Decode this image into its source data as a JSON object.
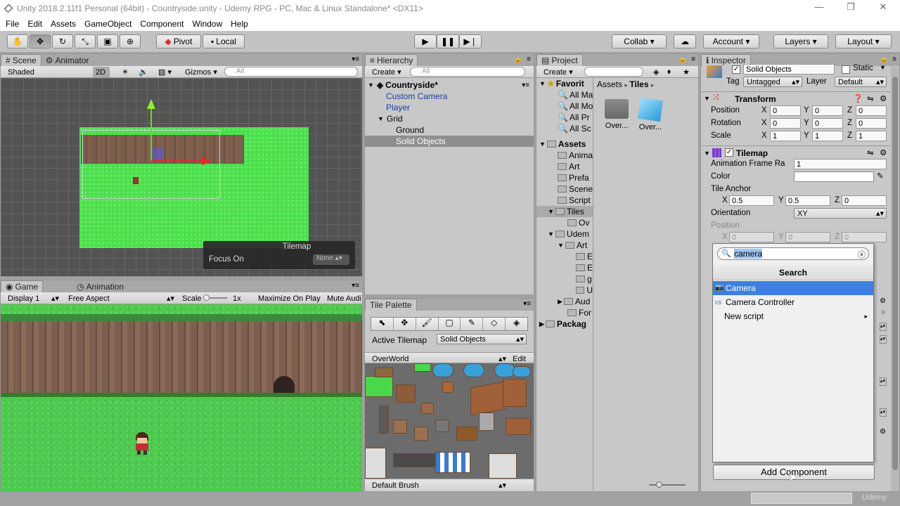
{
  "window": {
    "title": "Unity 2018.2.11f1 Personal (64bit) - Countryside.unity - Udemy RPG - PC, Mac & Linux Standalone* <DX11>"
  },
  "menu": [
    "File",
    "Edit",
    "Assets",
    "GameObject",
    "Component",
    "Window",
    "Help"
  ],
  "toolbar": {
    "pivot": "Pivot",
    "local": "Local",
    "collab": "Collab ▾",
    "account": "Account ▾",
    "layers": "Layers ▾",
    "layout": "Layout ▾"
  },
  "scene": {
    "tab": "Scene",
    "tab2": "Animator",
    "shading": "Shaded",
    "mode2d": "2D",
    "gizmos": "Gizmos ▾",
    "search_placeholder": "All",
    "overlay_title": "Tilemap",
    "focus_label": "Focus On",
    "focus_value": "None"
  },
  "game": {
    "tab": "Game",
    "tab2": "Animation",
    "display": "Display 1",
    "aspect": "Free Aspect",
    "scale_label": "Scale",
    "scale_value": "1x",
    "maximize": "Maximize On Play",
    "mute": "Mute Audi"
  },
  "hierarchy": {
    "tab": "Hierarchy",
    "create": "Create ▾",
    "search_placeholder": "All",
    "scene": "Countryside*",
    "items": [
      "Custom Camera",
      "Player",
      "Grid",
      "Ground",
      "Solid Objects"
    ]
  },
  "palette": {
    "tab": "Tile Palette",
    "active_label": "Active Tilemap",
    "active_value": "Solid Objects",
    "palette_name": "OverWorld",
    "edit": "Edit",
    "brush": "Default Brush"
  },
  "project": {
    "tab": "Project",
    "create": "Create ▾",
    "breadcrumb_assets": "Assets",
    "breadcrumb_tiles": "Tiles",
    "favorites": "Favorit",
    "fav_items": [
      "All Ma",
      "All Mo",
      "All Pr",
      "All Sc"
    ],
    "assets": "Assets",
    "asset_items": [
      "Anima",
      "Art",
      "Prefa",
      "Scene",
      "Script",
      "Tiles",
      "Ov",
      "Udem",
      "Art",
      "E",
      "E",
      "g",
      "U",
      "Aud",
      "For"
    ],
    "packages": "Packag",
    "grid_items": [
      "Over...",
      "Over..."
    ]
  },
  "inspector": {
    "tab": "Inspector",
    "object_name": "Solid Objects",
    "static": "Static",
    "tag_label": "Tag",
    "tag_value": "Untagged",
    "layer_label": "Layer",
    "layer_value": "Default",
    "transform": "Transform",
    "position": "Position",
    "rotation": "Rotation",
    "scale": "Scale",
    "pos": [
      "0",
      "0",
      "0"
    ],
    "rot": [
      "0",
      "0",
      "0"
    ],
    "scl": [
      "1",
      "1",
      "1"
    ],
    "tilemap": "Tilemap",
    "anim_rate_label": "Animation Frame Ra",
    "anim_rate": "1",
    "color": "Color",
    "tile_anchor": "Tile Anchor",
    "anchor": [
      "0.5",
      "0.5",
      "0"
    ],
    "orientation": "Orientation",
    "orientation_value": "XY",
    "position2": "Position",
    "pos2": [
      "0",
      "0",
      "0"
    ],
    "x": "X",
    "y": "Y",
    "z": "Z"
  },
  "addcomp": {
    "search_value": "camera",
    "header": "Search",
    "items": [
      "Camera",
      "Camera Controller",
      "New script"
    ],
    "button": "Add Component"
  },
  "watermark": "Udemy"
}
